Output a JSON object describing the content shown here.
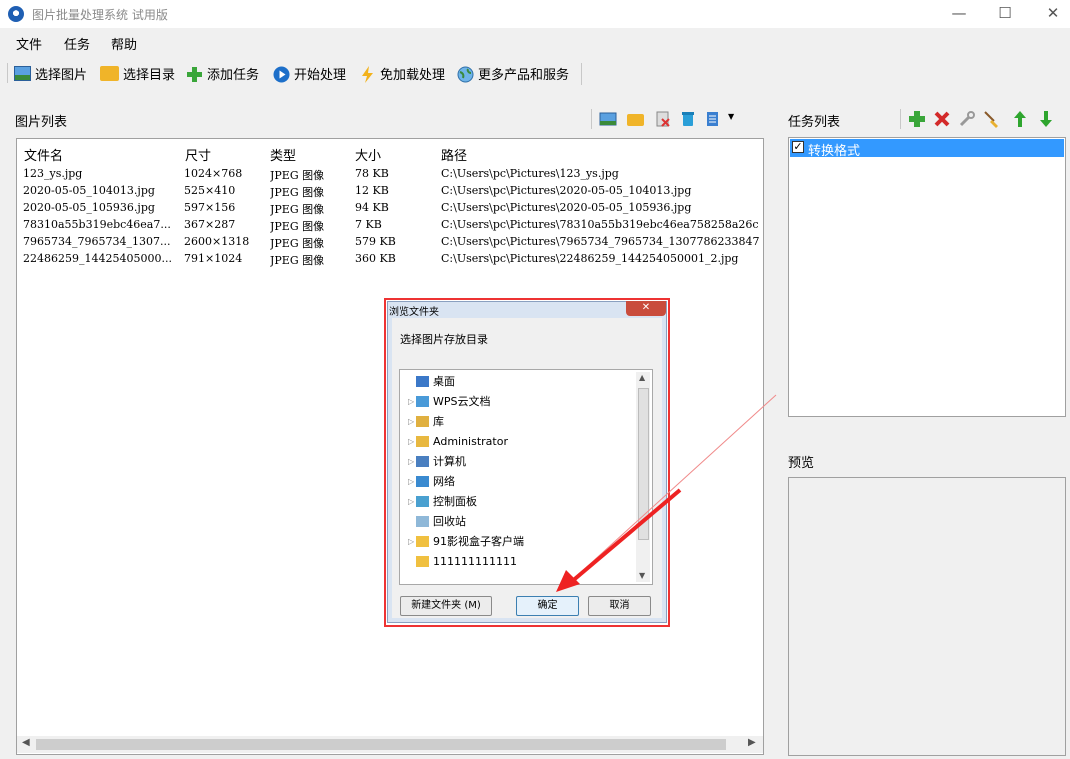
{
  "window": {
    "title": "图片批量处理系统 试用版",
    "minimize": "—",
    "maximize": "☐",
    "close": "✕"
  },
  "menu": [
    "文件",
    "任务",
    "帮助"
  ],
  "toolbar": [
    {
      "label": "选择图片",
      "icon": "image-icon"
    },
    {
      "label": "选择目录",
      "icon": "folder-icon"
    },
    {
      "label": "添加任务",
      "icon": "plus-icon"
    },
    {
      "label": "开始处理",
      "icon": "play-icon"
    },
    {
      "label": "免加载处理",
      "icon": "lightning-icon"
    },
    {
      "label": "更多产品和服务",
      "icon": "globe-icon"
    }
  ],
  "image_list": {
    "label": "图片列表",
    "columns": [
      "文件名",
      "尺寸",
      "类型",
      "大小",
      "路径"
    ],
    "rows": [
      [
        "123_ys.jpg",
        "1024×768",
        "JPEG 图像",
        "78 KB",
        "C:\\Users\\pc\\Pictures\\123_ys.jpg"
      ],
      [
        "2020-05-05_104013.jpg",
        "525×410",
        "JPEG 图像",
        "12 KB",
        "C:\\Users\\pc\\Pictures\\2020-05-05_104013.jpg"
      ],
      [
        "2020-05-05_105936.jpg",
        "597×156",
        "JPEG 图像",
        "94 KB",
        "C:\\Users\\pc\\Pictures\\2020-05-05_105936.jpg"
      ],
      [
        "78310a55b319ebc46ea7...",
        "367×287",
        "JPEG 图像",
        "7 KB",
        "C:\\Users\\pc\\Pictures\\78310a55b319ebc46ea758258a26c"
      ],
      [
        "7965734_7965734_1307...",
        "2600×1318",
        "JPEG 图像",
        "579 KB",
        "C:\\Users\\pc\\Pictures\\7965734_7965734_1307786233847"
      ],
      [
        "22486259_14425405000...",
        "791×1024",
        "JPEG 图像",
        "360 KB",
        "C:\\Users\\pc\\Pictures\\22486259_144254050001_2.jpg"
      ]
    ]
  },
  "task_list": {
    "label": "任务列表",
    "items": [
      {
        "label": "转换格式",
        "checked": true
      }
    ]
  },
  "preview": {
    "label": "预览"
  },
  "dialog": {
    "title": "浏览文件夹",
    "prompt": "选择图片存放目录",
    "tree": [
      {
        "label": "桌面",
        "expandable": false,
        "icon": "desktop-icon"
      },
      {
        "label": "WPS云文档",
        "expandable": true,
        "icon": "cloud-icon"
      },
      {
        "label": "库",
        "expandable": true,
        "icon": "library-icon"
      },
      {
        "label": "Administrator",
        "expandable": true,
        "icon": "user-folder-icon"
      },
      {
        "label": "计算机",
        "expandable": true,
        "icon": "computer-icon"
      },
      {
        "label": "网络",
        "expandable": true,
        "icon": "network-icon"
      },
      {
        "label": "控制面板",
        "expandable": true,
        "icon": "control-panel-icon"
      },
      {
        "label": "回收站",
        "expandable": false,
        "icon": "recycle-bin-icon"
      },
      {
        "label": "91影视盒子客户端",
        "expandable": true,
        "icon": "folder-icon"
      },
      {
        "label": "111111111111",
        "expandable": false,
        "icon": "folder-icon"
      }
    ],
    "new_folder": "新建文件夹 (M)",
    "ok": "确定",
    "cancel": "取消"
  }
}
